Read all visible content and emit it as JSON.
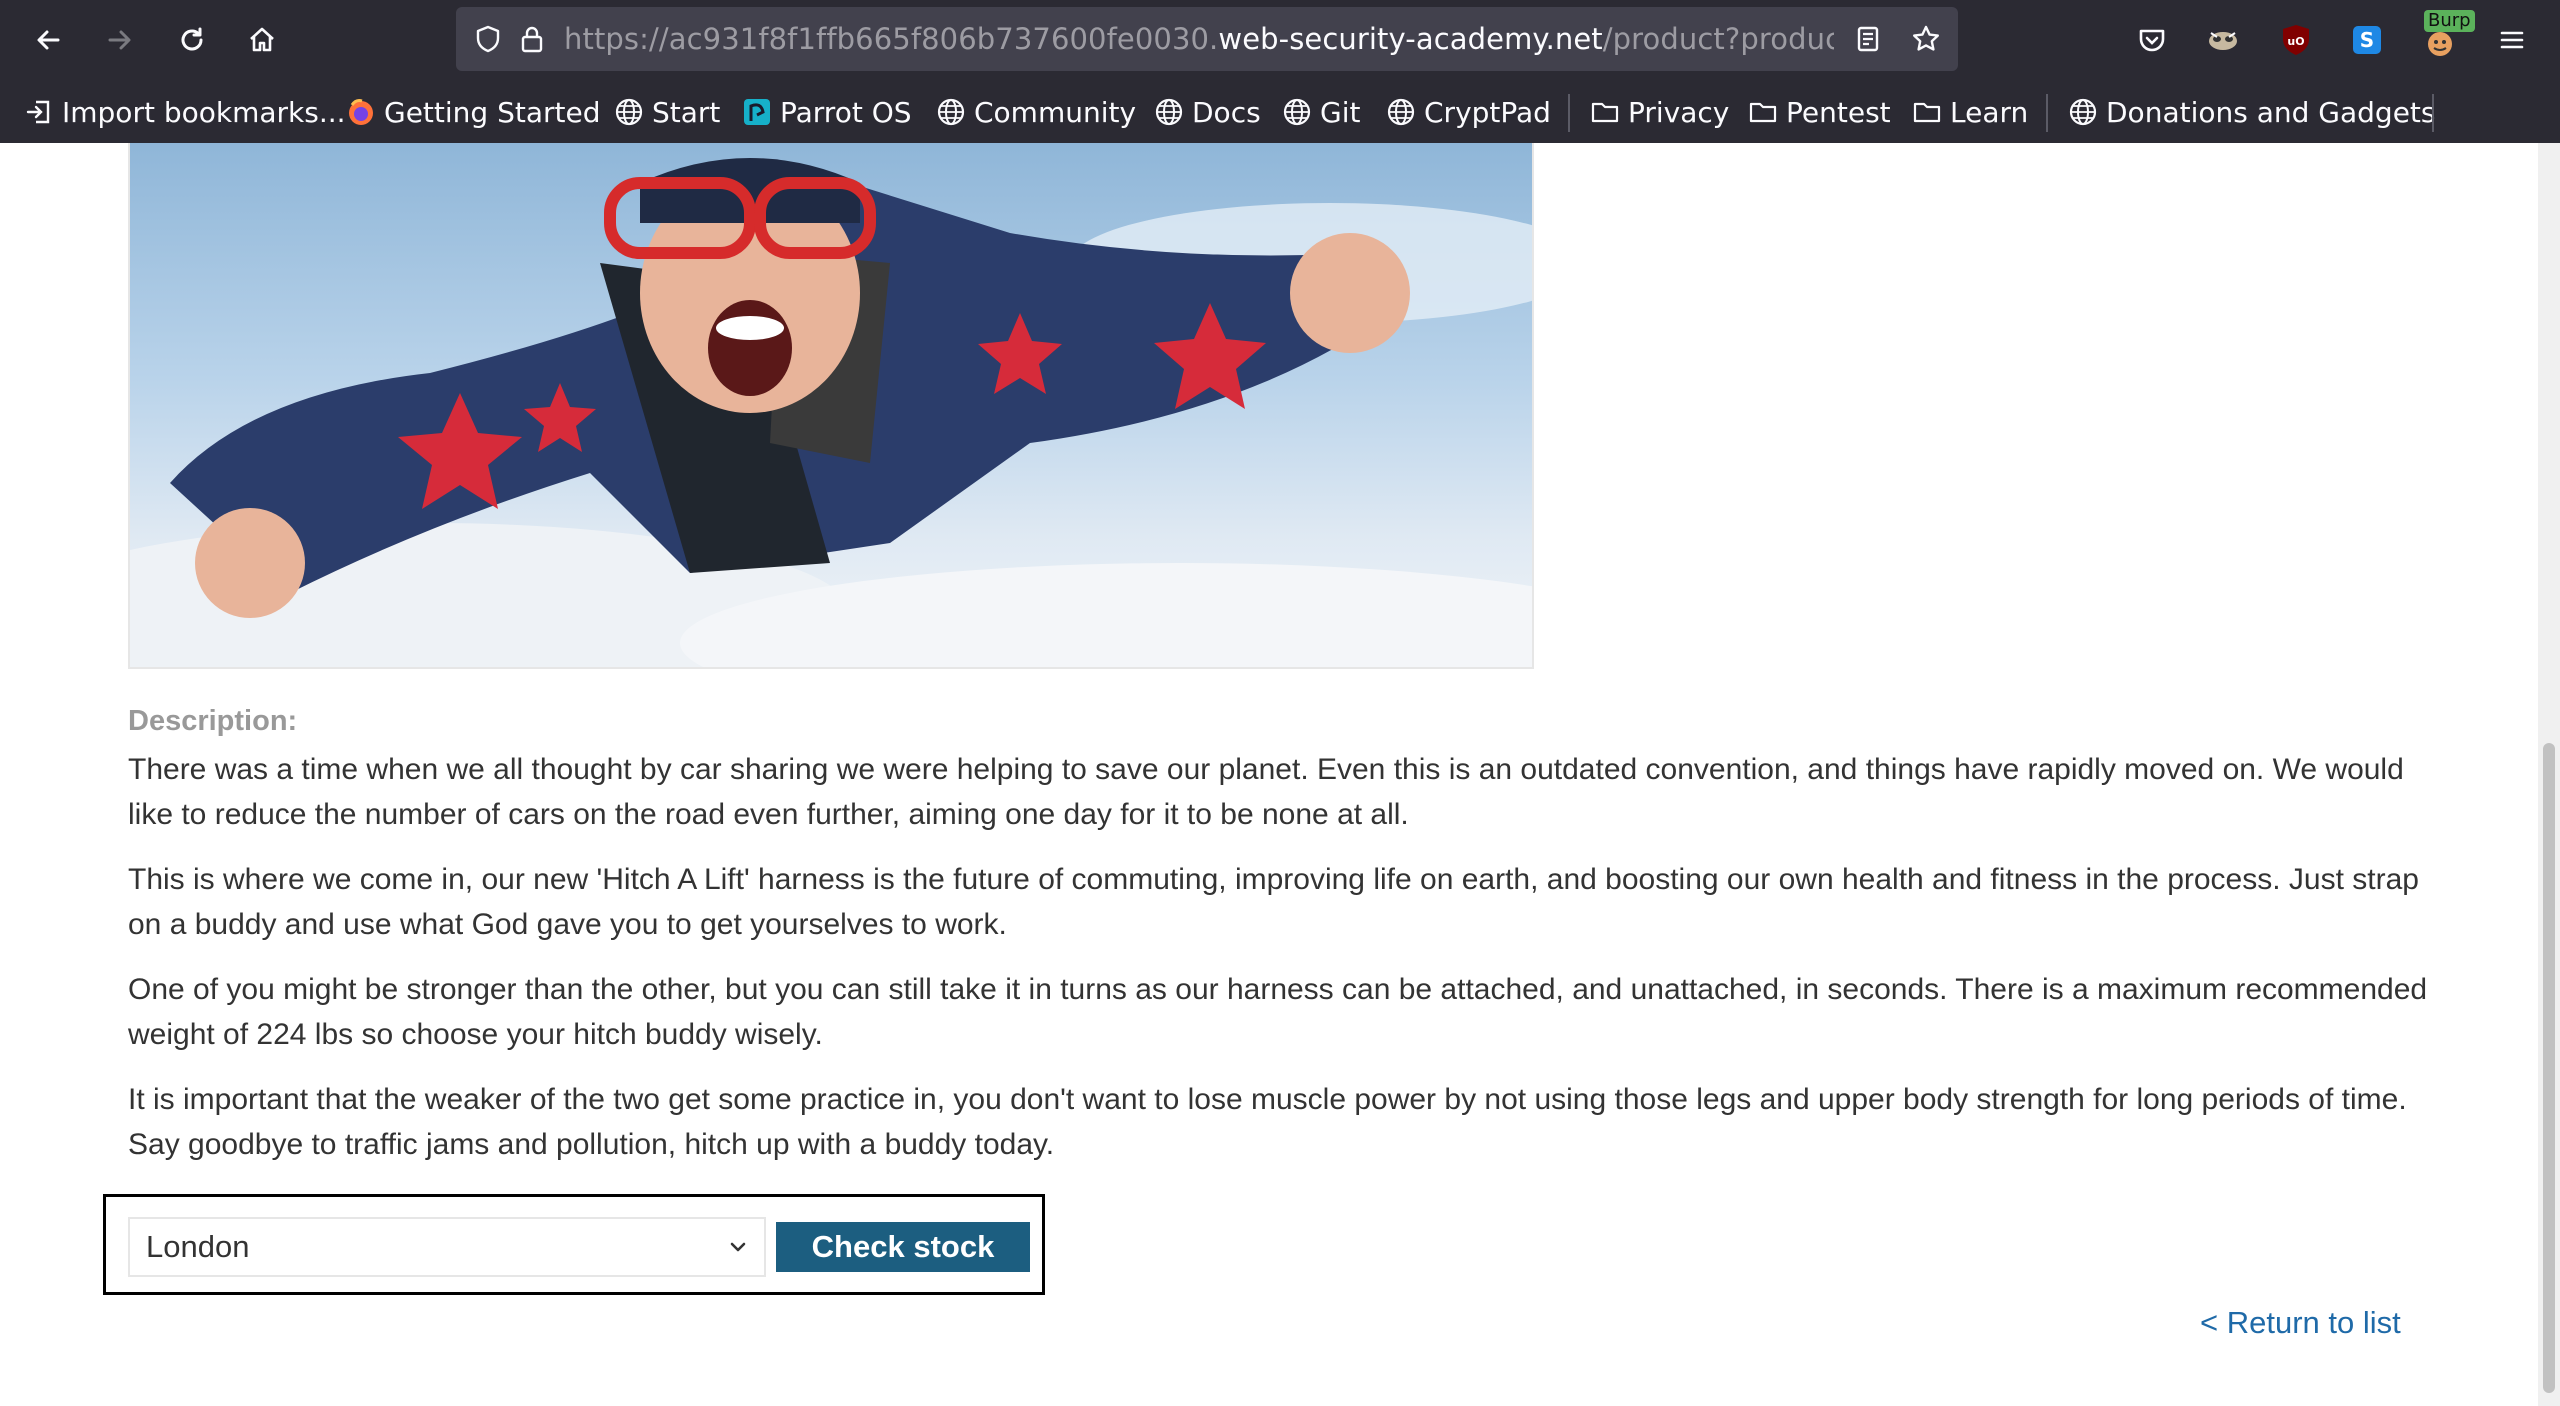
{
  "browser": {
    "url_prefix": "https://ac931f8f1ffb665f806b737600fe0030.",
    "url_domain": "web-security-academy.net",
    "url_path": "/product?productId",
    "extensions": [
      "pocket-icon",
      "extension-icon",
      "ublock-icon",
      "s-extension-icon",
      "burp-icon"
    ],
    "burp_badge": "Burp"
  },
  "bookmarks": {
    "items": [
      {
        "label": "Import bookmarks...",
        "icon": "import-icon"
      },
      {
        "label": "Getting Started",
        "icon": "firefox-icon"
      },
      {
        "label": "Start",
        "icon": "globe-icon"
      },
      {
        "label": "Parrot OS",
        "icon": "parrot-icon"
      },
      {
        "label": "Community",
        "icon": "globe-icon"
      },
      {
        "label": "Docs",
        "icon": "globe-icon"
      },
      {
        "label": "Git",
        "icon": "globe-icon"
      },
      {
        "label": "CryptPad",
        "icon": "globe-icon"
      },
      {
        "label": "Privacy",
        "icon": "folder-icon"
      },
      {
        "label": "Pentest",
        "icon": "folder-icon"
      },
      {
        "label": "Learn",
        "icon": "folder-icon"
      },
      {
        "label": "Donations and Gadgets",
        "icon": "globe-icon"
      }
    ]
  },
  "product": {
    "description_label": "Description:",
    "paragraphs": [
      "There was a time when we all thought by car sharing we were helping to save our planet. Even this is an outdated convention, and things have rapidly moved on. We would like to reduce the number of cars on the road even further, aiming one day for it to be none at all.",
      "This is where we come in, our new 'Hitch A Lift' harness is the future of commuting, improving life on earth, and boosting our own health and fitness in the process. Just strap on a buddy and use what God gave you to get yourselves to work.",
      "One of you might be stronger than the other, but you can still take it in turns as our harness can be attached, and unattached, in seconds. There is a maximum recommended weight of 224 lbs so choose your hitch buddy wisely.",
      "It is important that the weaker of the two get some practice in, you don't want to lose muscle power by not using those legs and upper body strength for long periods of time. Say goodbye to traffic jams and pollution, hitch up with a buddy today."
    ]
  },
  "stock": {
    "store_selected": "London",
    "check_button": "Check stock"
  },
  "return_link": "< Return to list",
  "colors": {
    "button_bg": "#1c5e80",
    "link": "#1f6aa8",
    "chrome_bg": "#2b2a33"
  }
}
